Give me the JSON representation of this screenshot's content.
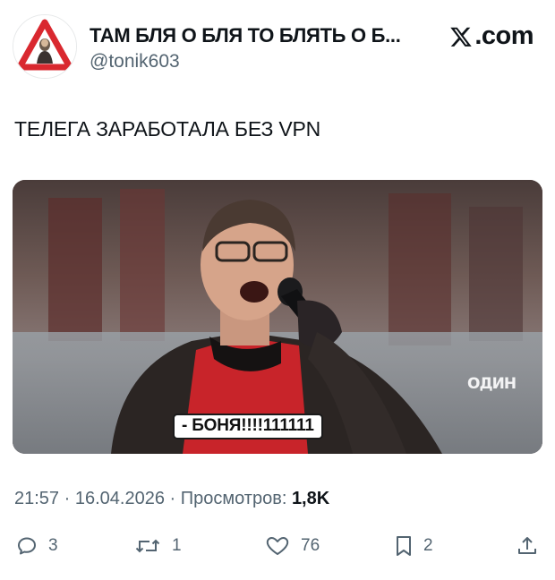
{
  "author": {
    "name": "ТАМ БЛЯ О БЛЯ ТО БЛЯТЬ О Б...",
    "handle": "@tonik603",
    "avatar_icon": "warning-sign-avatar"
  },
  "brand": {
    "label": ".com",
    "icon": "x-logo-icon"
  },
  "tweet": {
    "text": "ТЕЛЕГА ЗАРАБОТАЛА БЕЗ VPN"
  },
  "media": {
    "caption": "- БОНЯ!!!!111111",
    "channel_logo": "ОДИН"
  },
  "meta": {
    "time": "21:57",
    "separator1": " · ",
    "date": "16.04.2026",
    "separator2": " · ",
    "views_label": "Просмотров: ",
    "views_count": "1,8K"
  },
  "actions": {
    "replies": "3",
    "retweets": "1",
    "likes": "76",
    "bookmarks": "2"
  },
  "colors": {
    "text_primary": "#0f1419",
    "text_secondary": "#536471",
    "warning_red": "#d9282f"
  }
}
